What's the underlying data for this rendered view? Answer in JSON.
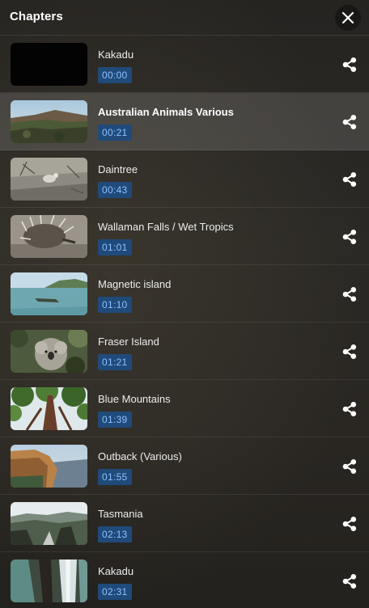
{
  "header": {
    "title": "Chapters",
    "close_icon": "close-icon"
  },
  "chapters": [
    {
      "title": "Kakadu",
      "time": "00:00",
      "thumb": "black"
    },
    {
      "title": "Australian Animals Various",
      "time": "00:21",
      "thumb": "cliff-landscape",
      "active": true
    },
    {
      "title": "Daintree",
      "time": "00:43",
      "thumb": "bird-on-ground"
    },
    {
      "title": "Wallaman Falls / Wet Tropics",
      "time": "01:01",
      "thumb": "echidna"
    },
    {
      "title": "Magnetic island",
      "time": "01:10",
      "thumb": "island-sea"
    },
    {
      "title": "Fraser Island",
      "time": "01:21",
      "thumb": "koala"
    },
    {
      "title": "Blue Mountains",
      "time": "01:39",
      "thumb": "tall-trees"
    },
    {
      "title": "Outback (Various)",
      "time": "01:55",
      "thumb": "canyon-cliff"
    },
    {
      "title": "Tasmania",
      "time": "02:13",
      "thumb": "mountain-valley"
    },
    {
      "title": "Kakadu",
      "time": "02:31",
      "thumb": "waterfall"
    }
  ],
  "share_icon": "share-icon",
  "colors": {
    "timestamp_bg": "#1f4a7a",
    "timestamp_text": "#8fc1ff",
    "active_row": "rgba(255,255,255,0.13)"
  }
}
